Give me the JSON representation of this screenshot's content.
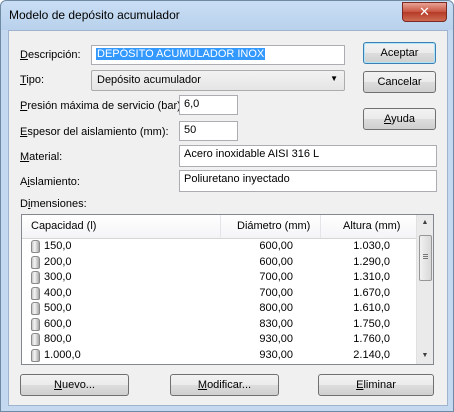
{
  "window": {
    "title": "Modelo de depósito acumulador",
    "close_label": "✕"
  },
  "form": {
    "descripcion": {
      "label": "Descripción:",
      "value": "DEPÓSITO ACUMULADOR INOX"
    },
    "tipo": {
      "label": "Tipo:",
      "value": "Depósito acumulador"
    },
    "presion": {
      "label": "Presión máxima de servicio (bar):",
      "value": "6,0"
    },
    "espesor": {
      "label": "Espesor del aislamiento (mm):",
      "value": "50"
    },
    "material": {
      "label": "Material:",
      "value": "Acero inoxidable AISI 316 L"
    },
    "aislamiento": {
      "label": "Aislamiento:",
      "value": "Poliuretano inyectado"
    }
  },
  "buttons": {
    "aceptar": "Aceptar",
    "cancelar": "Cancelar",
    "ayuda": "Ayuda",
    "nuevo": "Nuevo...",
    "modificar": "Modificar...",
    "eliminar": "Eliminar"
  },
  "dimensiones": {
    "label": "Dimensiones:",
    "columns": [
      "Capacidad (l)",
      "Diámetro (mm)",
      "Altura (mm)"
    ],
    "rows": [
      [
        "150,0",
        "600,00",
        "1.030,0"
      ],
      [
        "200,0",
        "600,00",
        "1.290,0"
      ],
      [
        "300,0",
        "700,00",
        "1.310,0"
      ],
      [
        "400,0",
        "700,00",
        "1.670,0"
      ],
      [
        "500,0",
        "800,00",
        "1.610,0"
      ],
      [
        "600,0",
        "830,00",
        "1.750,0"
      ],
      [
        "800,0",
        "930,00",
        "1.760,0"
      ],
      [
        "1.000,0",
        "930,00",
        "2.140,0"
      ]
    ]
  }
}
